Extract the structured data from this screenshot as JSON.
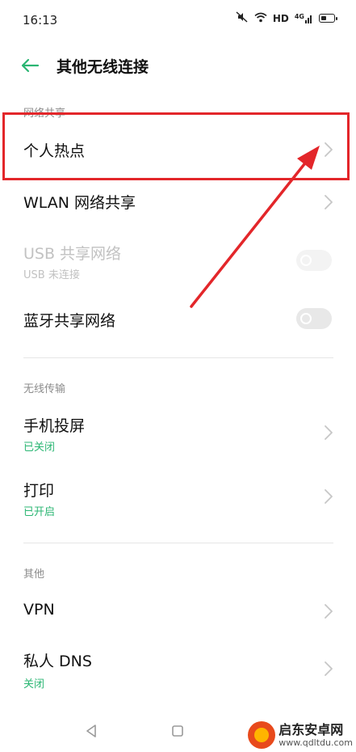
{
  "status_bar": {
    "time": "16:13",
    "hd_label": "HD",
    "signal_label": "4G"
  },
  "header": {
    "title": "其他无线连接"
  },
  "sections": {
    "network_sharing": {
      "header": "网络共享",
      "hotspot": {
        "title": "个人热点"
      },
      "wlan_sharing": {
        "title": "WLAN 网络共享"
      },
      "usb_sharing": {
        "title": "USB 共享网络",
        "subtitle": "USB 未连接",
        "enabled": false,
        "toggle_on": false
      },
      "bluetooth_sharing": {
        "title": "蓝牙共享网络",
        "toggle_on": false
      }
    },
    "wireless_transfer": {
      "header": "无线传输",
      "screen_cast": {
        "title": "手机投屏",
        "subtitle": "已关闭"
      },
      "print": {
        "title": "打印",
        "subtitle": "已开启"
      }
    },
    "other": {
      "header": "其他",
      "vpn": {
        "title": "VPN"
      },
      "private_dns": {
        "title": "私人 DNS",
        "subtitle": "关闭"
      }
    }
  },
  "watermark": {
    "name": "启东安卓网",
    "url": "www.qdltdu.com"
  },
  "colors": {
    "accent_green": "#2bb673",
    "annotation_red": "#e3262a",
    "text_primary": "#111111",
    "text_secondary": "#8c8c8c",
    "text_disabled": "#c2c2c2"
  }
}
